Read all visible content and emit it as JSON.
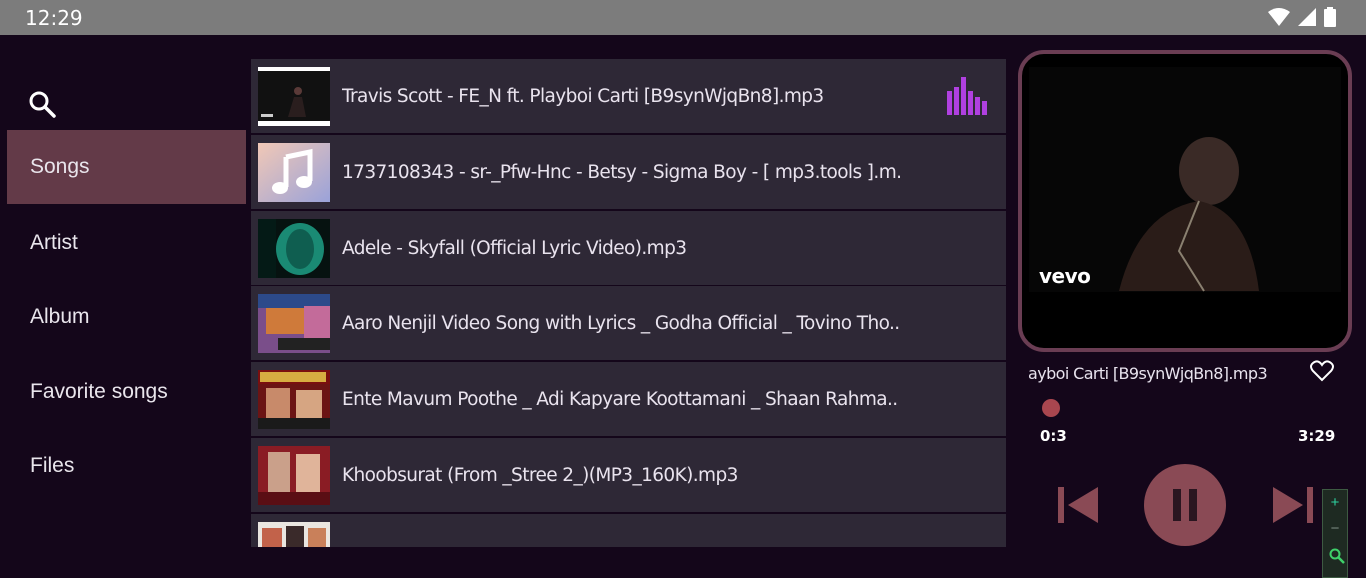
{
  "status_bar": {
    "time": "12:29"
  },
  "sidebar": {
    "items": [
      {
        "label": "Songs",
        "active": true
      },
      {
        "label": "Artist",
        "active": false
      },
      {
        "label": "Album",
        "active": false
      },
      {
        "label": "Favorite songs",
        "active": false
      },
      {
        "label": "Files",
        "active": false
      }
    ]
  },
  "songs": [
    {
      "title": "Travis Scott - FE_N ft. Playboi Carti [B9synWjqBn8].mp3",
      "playing": true
    },
    {
      "title": "1737108343 - sr-_Pfw-Hnc - Betsy - Sigma Boy - [ mp3.tools ].m..",
      "playing": false
    },
    {
      "title": "Adele - Skyfall (Official Lyric Video).mp3",
      "playing": false
    },
    {
      "title": "Aaro Nenjil Video Song with Lyrics _ Godha Official _ Tovino Tho..",
      "playing": false
    },
    {
      "title": "Ente Mavum Poothe _ Adi Kapyare Koottamani _ Shaan Rahma..",
      "playing": false
    },
    {
      "title": "Khoobsurat (From _Stree 2_)(MP3_160K).mp3",
      "playing": false
    },
    {
      "title": "",
      "playing": false
    }
  ],
  "player": {
    "now_playing_title": "ayboi Carti [B9synWjqBn8].mp3",
    "art_label": "vevo",
    "time_current": "0:3",
    "time_total": "3:29",
    "progress_fraction": 0.014
  },
  "zoom_panel": {
    "plus": "+",
    "minus": "−"
  },
  "colors": {
    "background": "#14061a",
    "row": "#2e2836",
    "active_nav": "#633a48",
    "accent": "#8a4a55",
    "equalizer": "#b040e0"
  }
}
